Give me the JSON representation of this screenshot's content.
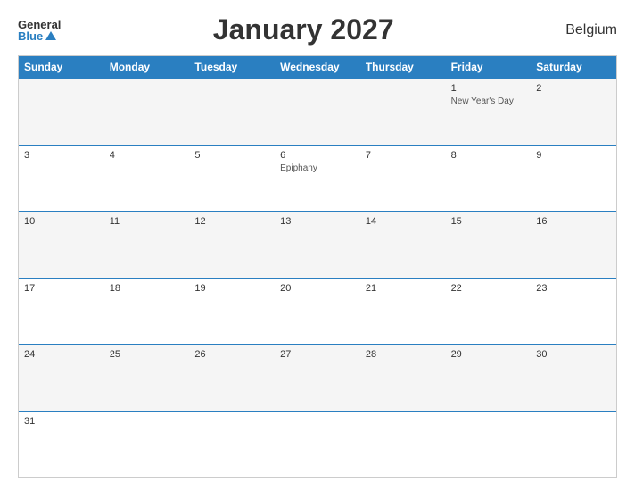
{
  "header": {
    "logo_general": "General",
    "logo_blue": "Blue",
    "title": "January 2027",
    "country": "Belgium"
  },
  "calendar": {
    "days_of_week": [
      "Sunday",
      "Monday",
      "Tuesday",
      "Wednesday",
      "Thursday",
      "Friday",
      "Saturday"
    ],
    "weeks": [
      [
        {
          "num": "",
          "event": ""
        },
        {
          "num": "",
          "event": ""
        },
        {
          "num": "",
          "event": ""
        },
        {
          "num": "",
          "event": ""
        },
        {
          "num": "",
          "event": ""
        },
        {
          "num": "1",
          "event": "New Year's Day"
        },
        {
          "num": "2",
          "event": ""
        }
      ],
      [
        {
          "num": "3",
          "event": ""
        },
        {
          "num": "4",
          "event": ""
        },
        {
          "num": "5",
          "event": ""
        },
        {
          "num": "6",
          "event": "Epiphany"
        },
        {
          "num": "7",
          "event": ""
        },
        {
          "num": "8",
          "event": ""
        },
        {
          "num": "9",
          "event": ""
        }
      ],
      [
        {
          "num": "10",
          "event": ""
        },
        {
          "num": "11",
          "event": ""
        },
        {
          "num": "12",
          "event": ""
        },
        {
          "num": "13",
          "event": ""
        },
        {
          "num": "14",
          "event": ""
        },
        {
          "num": "15",
          "event": ""
        },
        {
          "num": "16",
          "event": ""
        }
      ],
      [
        {
          "num": "17",
          "event": ""
        },
        {
          "num": "18",
          "event": ""
        },
        {
          "num": "19",
          "event": ""
        },
        {
          "num": "20",
          "event": ""
        },
        {
          "num": "21",
          "event": ""
        },
        {
          "num": "22",
          "event": ""
        },
        {
          "num": "23",
          "event": ""
        }
      ],
      [
        {
          "num": "24",
          "event": ""
        },
        {
          "num": "25",
          "event": ""
        },
        {
          "num": "26",
          "event": ""
        },
        {
          "num": "27",
          "event": ""
        },
        {
          "num": "28",
          "event": ""
        },
        {
          "num": "29",
          "event": ""
        },
        {
          "num": "30",
          "event": ""
        }
      ],
      [
        {
          "num": "31",
          "event": ""
        },
        {
          "num": "",
          "event": ""
        },
        {
          "num": "",
          "event": ""
        },
        {
          "num": "",
          "event": ""
        },
        {
          "num": "",
          "event": ""
        },
        {
          "num": "",
          "event": ""
        },
        {
          "num": "",
          "event": ""
        }
      ]
    ]
  }
}
